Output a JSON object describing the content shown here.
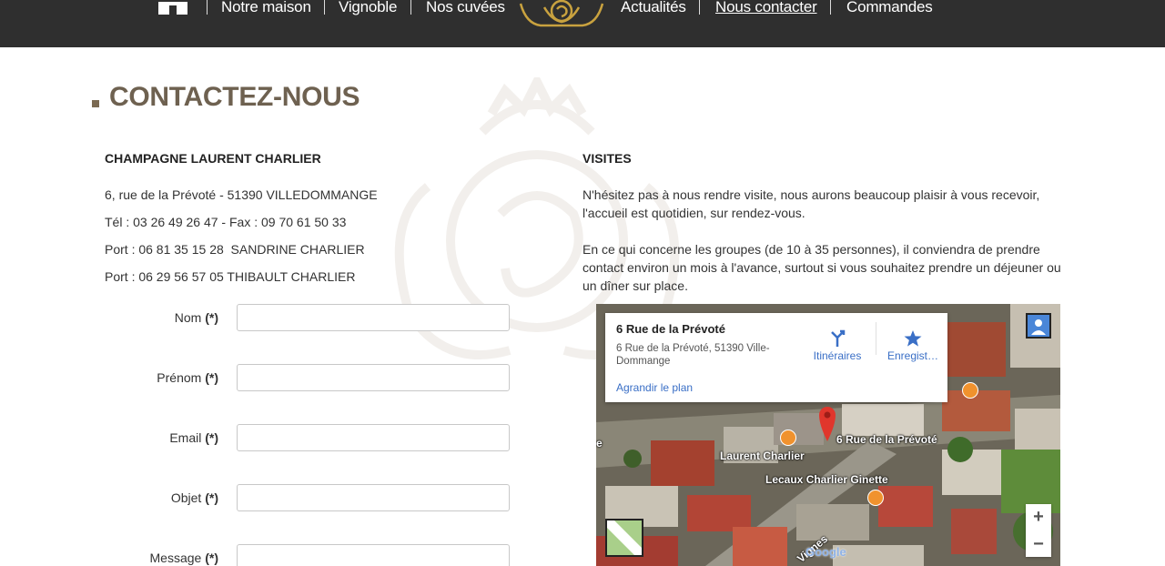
{
  "nav": {
    "items": [
      {
        "label": "Notre maison"
      },
      {
        "label": "Vignoble"
      },
      {
        "label": "Nos cuvées"
      },
      {
        "label": "Actualités"
      },
      {
        "label": "Nous contacter"
      },
      {
        "label": "Commandes"
      }
    ],
    "active": "Nous contacter",
    "home_icon": "home-icon",
    "logo_icon": "crest-logo"
  },
  "page": {
    "title": "CONTACTEZ-NOUS"
  },
  "contact": {
    "company": "CHAMPAGNE LAURENT CHARLIER",
    "address": "6, rue de la Prévoté - 51390 VILLEDOMMANGE",
    "phone": "Tél : 03 26 49 26 47 - Fax : 09 70 61 50 33",
    "mobile1": "Port : 06 81 35 15 28  SANDRINE CHARLIER",
    "mobile2": "Port : 06 29 56 57 05 THIBAULT CHARLIER"
  },
  "form": {
    "required_mark": "(*)",
    "fields": [
      {
        "label": "Nom",
        "value": ""
      },
      {
        "label": "Prénom",
        "value": ""
      },
      {
        "label": "Email",
        "value": ""
      },
      {
        "label": "Objet",
        "value": ""
      },
      {
        "label": "Message",
        "value": ""
      }
    ]
  },
  "visits": {
    "title": "VISITES",
    "para1": "N'hésitez pas à nous rendre visite, nous aurons beaucoup plaisir à vous recevoir, l'accueil est quotidien, sur rendez-vous.",
    "para2": "En ce qui concerne les groupes (de 10 à 35 personnes), il conviendra de prendre contact environ un mois à l'avance, surtout si vous souhaitez prendre un déjeuner ou un dîner sur place."
  },
  "map": {
    "card_title": "6 Rue de la Prévoté",
    "card_address": "6 Rue de la Prévoté, 51390 Ville-Dommange",
    "enlarge_link": "Agrandir le plan",
    "directions_label": "Itinéraires",
    "save_label": "Enregist…",
    "zoom_in": "+",
    "zoom_out": "−",
    "labels": {
      "pin": "6 Rue de la Prévoté",
      "poi1": "Laurent Charlier",
      "poi2": "Lecaux Charlier Ginette",
      "edge": "e",
      "road": "Vignes"
    },
    "google": "Google",
    "colors": {
      "poi": "#f0922e",
      "pin": "#e0362c",
      "link": "#3a6fc6"
    }
  },
  "colors": {
    "navbar": "#2f2f2f",
    "title": "#6e6150"
  }
}
